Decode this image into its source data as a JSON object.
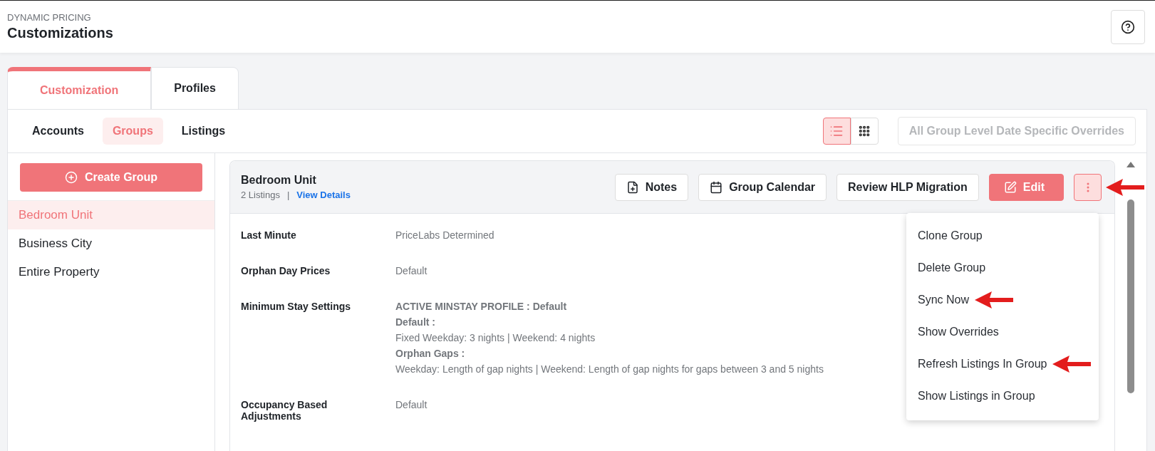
{
  "header": {
    "eyebrow": "DYNAMIC PRICING",
    "title": "Customizations"
  },
  "tabs": [
    {
      "label": "Customization",
      "selected": true
    },
    {
      "label": "Profiles",
      "selected": false
    }
  ],
  "subtabs": [
    {
      "label": "Accounts",
      "selected": false
    },
    {
      "label": "Groups",
      "selected": true
    },
    {
      "label": "Listings",
      "selected": false
    }
  ],
  "view_toggle": [
    {
      "kind": "list",
      "selected": true
    },
    {
      "kind": "grid",
      "selected": false
    }
  ],
  "overrides_button": {
    "label": "All Group Level Date Specific Overrides",
    "disabled": true
  },
  "create_group_button": {
    "label": "Create Group"
  },
  "groups": [
    {
      "name": "Bedroom Unit",
      "selected": true
    },
    {
      "name": "Business City",
      "selected": false
    },
    {
      "name": "Entire Property",
      "selected": false
    }
  ],
  "group_card": {
    "title": "Bedroom Unit",
    "count": "2 Listings",
    "separator": "|",
    "link": "View Details",
    "buttons": [
      {
        "kind": "notes",
        "label": "Notes"
      },
      {
        "kind": "calendar",
        "label": "Group Calendar"
      },
      {
        "kind": "plain",
        "label": "Review HLP Migration"
      },
      {
        "kind": "edit",
        "label": "Edit"
      },
      {
        "kind": "more",
        "marked": true
      }
    ],
    "settings": [
      {
        "label": "Last Minute",
        "lines": [
          {
            "text": "PriceLabs Determined",
            "bold": false
          }
        ]
      },
      {
        "label": "Orphan Day Prices",
        "lines": [
          {
            "text": "Default",
            "bold": false
          }
        ]
      },
      {
        "label": "Minimum Stay Settings",
        "lines": [
          {
            "text": "ACTIVE MINSTAY PROFILE : Default",
            "bold": true
          },
          {
            "text": "Default :",
            "bold": true
          },
          {
            "text": "Fixed Weekday: 3 nights | Weekend: 4 nights",
            "bold": false
          },
          {
            "text": "Orphan Gaps :",
            "bold": true
          },
          {
            "text": "Weekday: Length of gap nights | Weekend: Length of gap nights for gaps between 3 and 5 nights",
            "bold": false
          }
        ]
      },
      {
        "label": "Occupancy Based Adjustments",
        "lines": [
          {
            "text": "Default",
            "bold": false
          }
        ]
      }
    ]
  },
  "menu": {
    "items": [
      {
        "label": "Clone Group",
        "marked": false
      },
      {
        "label": "Delete Group",
        "marked": false
      },
      {
        "label": "Sync Now",
        "marked": true
      },
      {
        "label": "Show Overrides",
        "marked": false
      },
      {
        "label": "Refresh Listings In Group",
        "marked": true
      },
      {
        "label": "Show Listings in Group",
        "marked": false
      }
    ]
  }
}
